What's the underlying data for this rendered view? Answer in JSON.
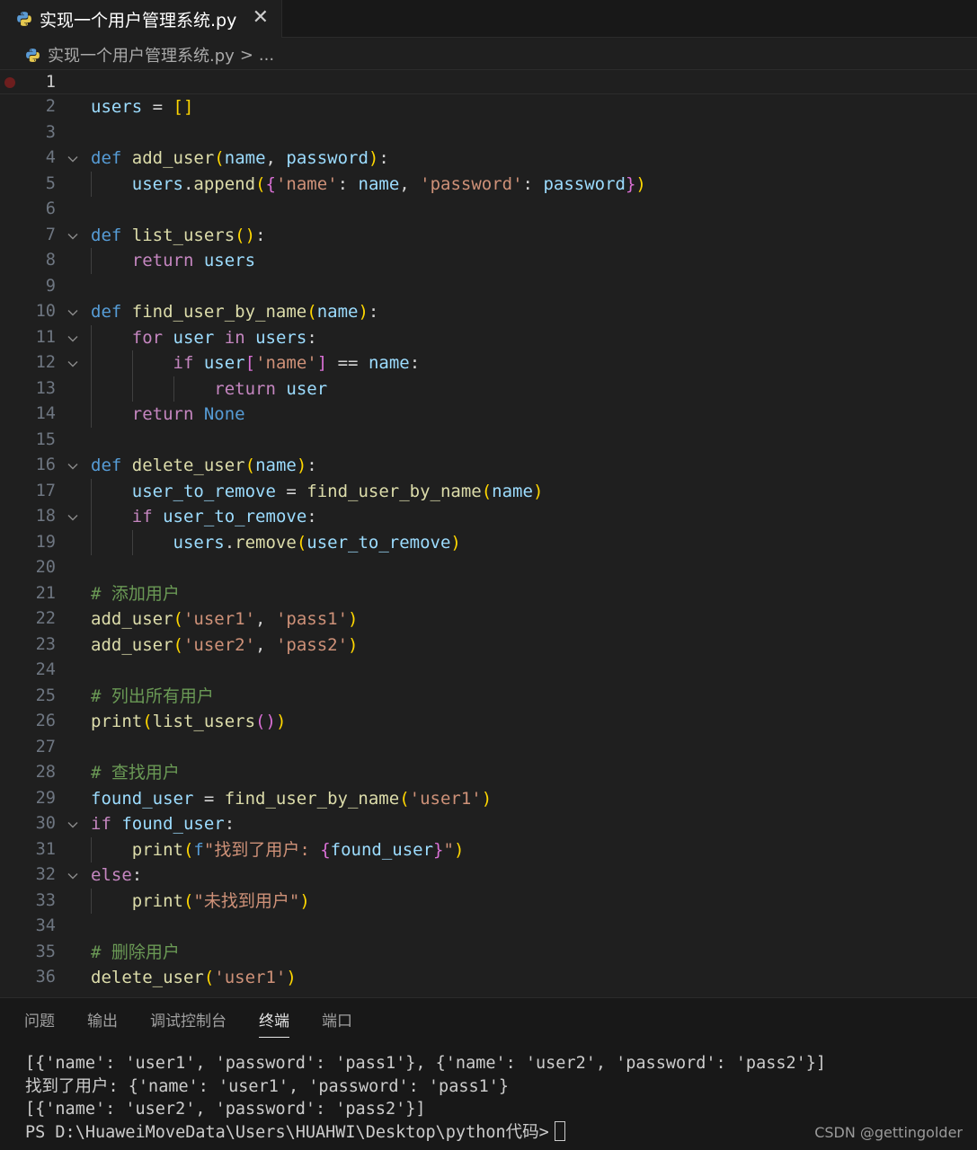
{
  "tab": {
    "title": "实现一个用户管理系统.py",
    "close": "✕"
  },
  "breadcrumb": {
    "file": "实现一个用户管理系统.py",
    "sep": ">",
    "more": "..."
  },
  "editor": {
    "lines": [
      {
        "n": "1",
        "fold": false,
        "tokens": []
      },
      {
        "n": "2",
        "fold": false,
        "tokens": [
          [
            "vr",
            "users"
          ],
          [
            "pl",
            " = "
          ],
          [
            "bk",
            "[]"
          ]
        ]
      },
      {
        "n": "3",
        "fold": false,
        "tokens": []
      },
      {
        "n": "4",
        "fold": true,
        "tokens": [
          [
            "kw",
            "def"
          ],
          [
            "pl",
            " "
          ],
          [
            "fn",
            "add_user"
          ],
          [
            "bk",
            "("
          ],
          [
            "vr",
            "name"
          ],
          [
            "pl",
            ", "
          ],
          [
            "vr",
            "password"
          ],
          [
            "bk",
            ")"
          ],
          [
            "pl",
            ":"
          ]
        ]
      },
      {
        "n": "5",
        "fold": false,
        "tokens": [
          [
            "pl",
            "    "
          ],
          [
            "vr",
            "users"
          ],
          [
            "pl",
            "."
          ],
          [
            "fn",
            "append"
          ],
          [
            "bk",
            "("
          ],
          [
            "bk2",
            "{"
          ],
          [
            "st",
            "'name'"
          ],
          [
            "pl",
            ": "
          ],
          [
            "vr",
            "name"
          ],
          [
            "pl",
            ", "
          ],
          [
            "st",
            "'password'"
          ],
          [
            "pl",
            ": "
          ],
          [
            "vr",
            "password"
          ],
          [
            "bk2",
            "}"
          ],
          [
            "bk",
            ")"
          ]
        ]
      },
      {
        "n": "6",
        "fold": false,
        "tokens": []
      },
      {
        "n": "7",
        "fold": true,
        "tokens": [
          [
            "kw",
            "def"
          ],
          [
            "pl",
            " "
          ],
          [
            "fn",
            "list_users"
          ],
          [
            "bk",
            "()"
          ],
          [
            "pl",
            ":"
          ]
        ]
      },
      {
        "n": "8",
        "fold": false,
        "tokens": [
          [
            "pl",
            "    "
          ],
          [
            "ctl",
            "return"
          ],
          [
            "pl",
            " "
          ],
          [
            "vr",
            "users"
          ]
        ]
      },
      {
        "n": "9",
        "fold": false,
        "tokens": []
      },
      {
        "n": "10",
        "fold": true,
        "tokens": [
          [
            "kw",
            "def"
          ],
          [
            "pl",
            " "
          ],
          [
            "fn",
            "find_user_by_name"
          ],
          [
            "bk",
            "("
          ],
          [
            "vr",
            "name"
          ],
          [
            "bk",
            ")"
          ],
          [
            "pl",
            ":"
          ]
        ]
      },
      {
        "n": "11",
        "fold": true,
        "tokens": [
          [
            "pl",
            "    "
          ],
          [
            "ctl",
            "for"
          ],
          [
            "pl",
            " "
          ],
          [
            "vr",
            "user"
          ],
          [
            "pl",
            " "
          ],
          [
            "ctl",
            "in"
          ],
          [
            "pl",
            " "
          ],
          [
            "vr",
            "users"
          ],
          [
            "pl",
            ":"
          ]
        ]
      },
      {
        "n": "12",
        "fold": true,
        "tokens": [
          [
            "pl",
            "        "
          ],
          [
            "ctl",
            "if"
          ],
          [
            "pl",
            " "
          ],
          [
            "vr",
            "user"
          ],
          [
            "bk2",
            "["
          ],
          [
            "st",
            "'name'"
          ],
          [
            "bk2",
            "]"
          ],
          [
            "pl",
            " == "
          ],
          [
            "vr",
            "name"
          ],
          [
            "pl",
            ":"
          ]
        ]
      },
      {
        "n": "13",
        "fold": false,
        "tokens": [
          [
            "pl",
            "            "
          ],
          [
            "ctl",
            "return"
          ],
          [
            "pl",
            " "
          ],
          [
            "vr",
            "user"
          ]
        ]
      },
      {
        "n": "14",
        "fold": false,
        "tokens": [
          [
            "pl",
            "    "
          ],
          [
            "ctl",
            "return"
          ],
          [
            "pl",
            " "
          ],
          [
            "kw",
            "None"
          ]
        ]
      },
      {
        "n": "15",
        "fold": false,
        "tokens": []
      },
      {
        "n": "16",
        "fold": true,
        "tokens": [
          [
            "kw",
            "def"
          ],
          [
            "pl",
            " "
          ],
          [
            "fn",
            "delete_user"
          ],
          [
            "bk",
            "("
          ],
          [
            "vr",
            "name"
          ],
          [
            "bk",
            ")"
          ],
          [
            "pl",
            ":"
          ]
        ]
      },
      {
        "n": "17",
        "fold": false,
        "tokens": [
          [
            "pl",
            "    "
          ],
          [
            "vr",
            "user_to_remove"
          ],
          [
            "pl",
            " = "
          ],
          [
            "fn",
            "find_user_by_name"
          ],
          [
            "bk",
            "("
          ],
          [
            "vr",
            "name"
          ],
          [
            "bk",
            ")"
          ]
        ]
      },
      {
        "n": "18",
        "fold": true,
        "tokens": [
          [
            "pl",
            "    "
          ],
          [
            "ctl",
            "if"
          ],
          [
            "pl",
            " "
          ],
          [
            "vr",
            "user_to_remove"
          ],
          [
            "pl",
            ":"
          ]
        ]
      },
      {
        "n": "19",
        "fold": false,
        "tokens": [
          [
            "pl",
            "        "
          ],
          [
            "vr",
            "users"
          ],
          [
            "pl",
            "."
          ],
          [
            "fn",
            "remove"
          ],
          [
            "bk",
            "("
          ],
          [
            "vr",
            "user_to_remove"
          ],
          [
            "bk",
            ")"
          ]
        ]
      },
      {
        "n": "20",
        "fold": false,
        "tokens": []
      },
      {
        "n": "21",
        "fold": false,
        "tokens": [
          [
            "cm",
            "# 添加用户"
          ]
        ]
      },
      {
        "n": "22",
        "fold": false,
        "tokens": [
          [
            "fn",
            "add_user"
          ],
          [
            "bk",
            "("
          ],
          [
            "st",
            "'user1'"
          ],
          [
            "pl",
            ", "
          ],
          [
            "st",
            "'pass1'"
          ],
          [
            "bk",
            ")"
          ]
        ]
      },
      {
        "n": "23",
        "fold": false,
        "tokens": [
          [
            "fn",
            "add_user"
          ],
          [
            "bk",
            "("
          ],
          [
            "st",
            "'user2'"
          ],
          [
            "pl",
            ", "
          ],
          [
            "st",
            "'pass2'"
          ],
          [
            "bk",
            ")"
          ]
        ]
      },
      {
        "n": "24",
        "fold": false,
        "tokens": []
      },
      {
        "n": "25",
        "fold": false,
        "tokens": [
          [
            "cm",
            "# 列出所有用户"
          ]
        ]
      },
      {
        "n": "26",
        "fold": false,
        "tokens": [
          [
            "fn",
            "print"
          ],
          [
            "bk",
            "("
          ],
          [
            "fn",
            "list_users"
          ],
          [
            "bk2",
            "()"
          ],
          [
            "bk",
            ")"
          ]
        ]
      },
      {
        "n": "27",
        "fold": false,
        "tokens": []
      },
      {
        "n": "28",
        "fold": false,
        "tokens": [
          [
            "cm",
            "# 查找用户"
          ]
        ]
      },
      {
        "n": "29",
        "fold": false,
        "tokens": [
          [
            "vr",
            "found_user"
          ],
          [
            "pl",
            " = "
          ],
          [
            "fn",
            "find_user_by_name"
          ],
          [
            "bk",
            "("
          ],
          [
            "st",
            "'user1'"
          ],
          [
            "bk",
            ")"
          ]
        ]
      },
      {
        "n": "30",
        "fold": true,
        "tokens": [
          [
            "ctl",
            "if"
          ],
          [
            "pl",
            " "
          ],
          [
            "vr",
            "found_user"
          ],
          [
            "pl",
            ":"
          ]
        ]
      },
      {
        "n": "31",
        "fold": false,
        "tokens": [
          [
            "pl",
            "    "
          ],
          [
            "fn",
            "print"
          ],
          [
            "bk",
            "("
          ],
          [
            "kw",
            "f"
          ],
          [
            "st",
            "\"找到了用户: "
          ],
          [
            "bk2",
            "{"
          ],
          [
            "vr",
            "found_user"
          ],
          [
            "bk2",
            "}"
          ],
          [
            "st",
            "\""
          ],
          [
            "bk",
            ")"
          ]
        ]
      },
      {
        "n": "32",
        "fold": true,
        "tokens": [
          [
            "ctl",
            "else"
          ],
          [
            "pl",
            ":"
          ]
        ]
      },
      {
        "n": "33",
        "fold": false,
        "tokens": [
          [
            "pl",
            "    "
          ],
          [
            "fn",
            "print"
          ],
          [
            "bk",
            "("
          ],
          [
            "st",
            "\"未找到用户\""
          ],
          [
            "bk",
            ")"
          ]
        ]
      },
      {
        "n": "34",
        "fold": false,
        "tokens": []
      },
      {
        "n": "35",
        "fold": false,
        "tokens": [
          [
            "cm",
            "# 删除用户"
          ]
        ]
      },
      {
        "n": "36",
        "fold": false,
        "tokens": [
          [
            "fn",
            "delete_user"
          ],
          [
            "bk",
            "("
          ],
          [
            "st",
            "'user1'"
          ],
          [
            "bk",
            ")"
          ]
        ]
      }
    ]
  },
  "panel": {
    "tabs": [
      "问题",
      "输出",
      "调试控制台",
      "终端",
      "端口"
    ],
    "active_tab": "终端",
    "terminal_lines": [
      "[{'name': 'user1', 'password': 'pass1'}, {'name': 'user2', 'password': 'pass2'}]",
      "找到了用户: {'name': 'user1', 'password': 'pass1'}",
      "[{'name': 'user2', 'password': 'pass2'}]",
      "PS D:\\HuaweiMoveData\\Users\\HUAHWI\\Desktop\\python代码>"
    ]
  },
  "watermark": "CSDN @gettingolder",
  "colors": {
    "keyword": "#569cd6",
    "control": "#c586c0",
    "function": "#dcdcaa",
    "variable": "#9cdcfe",
    "string": "#ce9178",
    "comment": "#6a9955",
    "bracket": "#ffd700"
  },
  "icons": {
    "file": "python-file-icon",
    "fold": "chevron-down-icon",
    "breakpoint": "breakpoint-icon"
  }
}
